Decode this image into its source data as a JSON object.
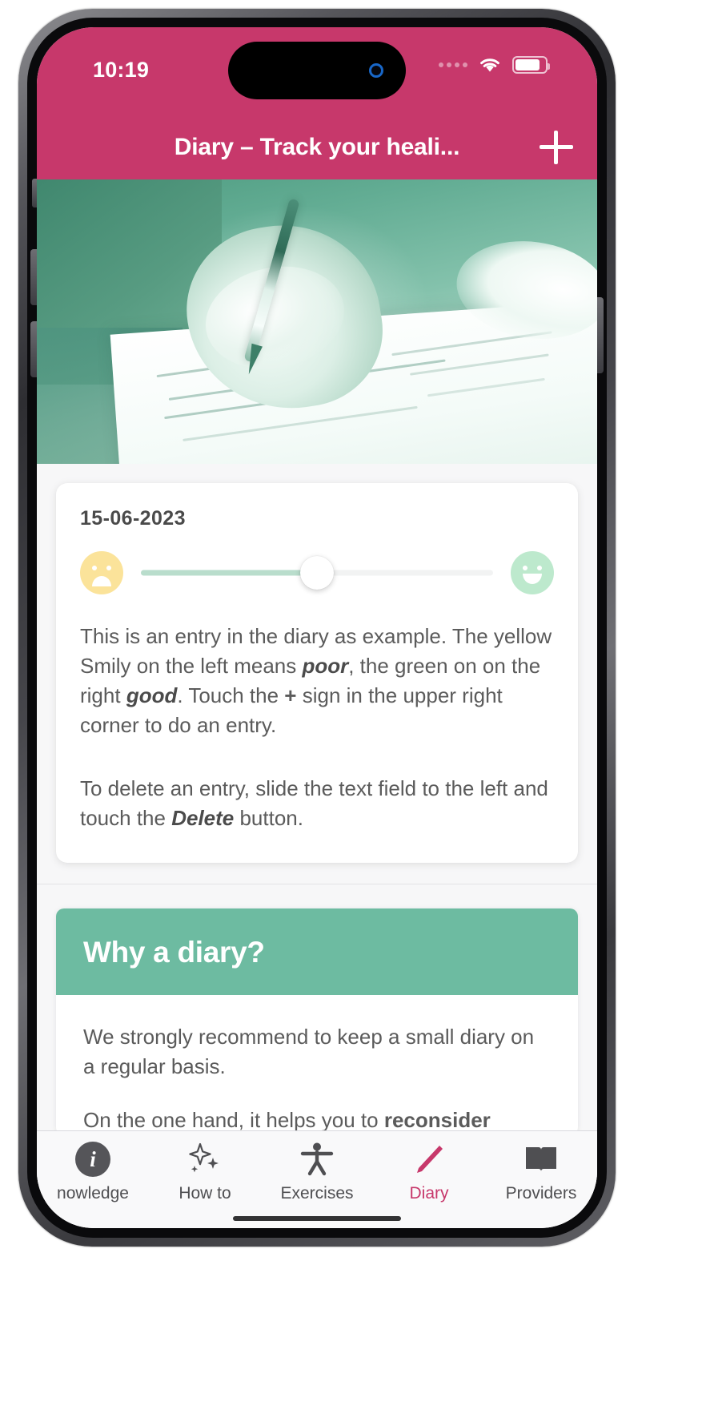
{
  "status_bar": {
    "time": "10:19",
    "wifi_icon": "wifi-icon",
    "battery_icon": "battery-icon",
    "cellular_icon": "cellular-dots-icon"
  },
  "nav": {
    "title": "Diary – Track your heali...",
    "add_icon": "plus-icon"
  },
  "hero": {
    "image_alt": "hand writing with a pen in a notebook"
  },
  "entry": {
    "date": "15-06-2023",
    "mood_value": 50,
    "mood_left_icon": "sad-smiley-icon",
    "mood_right_icon": "happy-smiley-icon",
    "paragraph_1_part_1": "This is an entry in the diary as example. The yellow Smily on the left means ",
    "paragraph_1_bold_1": "poor",
    "paragraph_1_part_2": ", the green on on the right ",
    "paragraph_1_bold_2": "good",
    "paragraph_1_part_3": ". Touch the ",
    "paragraph_1_plus": "+",
    "paragraph_1_part_4": " sign in the upper right corner to do an entry.",
    "paragraph_2_part_1": "To delete an entry, slide the text field to the left and touch the ",
    "paragraph_2_bold_1": "Delete",
    "paragraph_2_part_2": " button."
  },
  "why_card": {
    "title": "Why a diary?",
    "paragraph_1": "We strongly recommend to keep a small diary on a regular basis.",
    "paragraph_2_part_1": "On the one hand, it helps you to ",
    "paragraph_2_bold_1": "reconsider"
  },
  "tab_bar": {
    "items": [
      {
        "label": "nowledge",
        "icon": "info-circle-icon",
        "active": false
      },
      {
        "label": "How to",
        "icon": "sparkles-icon",
        "active": false
      },
      {
        "label": "Exercises",
        "icon": "person-icon",
        "active": false
      },
      {
        "label": "Diary",
        "icon": "pencil-icon",
        "active": true
      },
      {
        "label": "Providers",
        "icon": "open-book-icon",
        "active": false
      }
    ]
  },
  "colors": {
    "brand_pink": "#c7386b",
    "brand_green": "#6dbba1",
    "slider_fill": "#b9ddcc",
    "smiley_sad": "#fbe39a",
    "smiley_happy": "#bde9cd",
    "text_body": "#5b5b5b"
  }
}
